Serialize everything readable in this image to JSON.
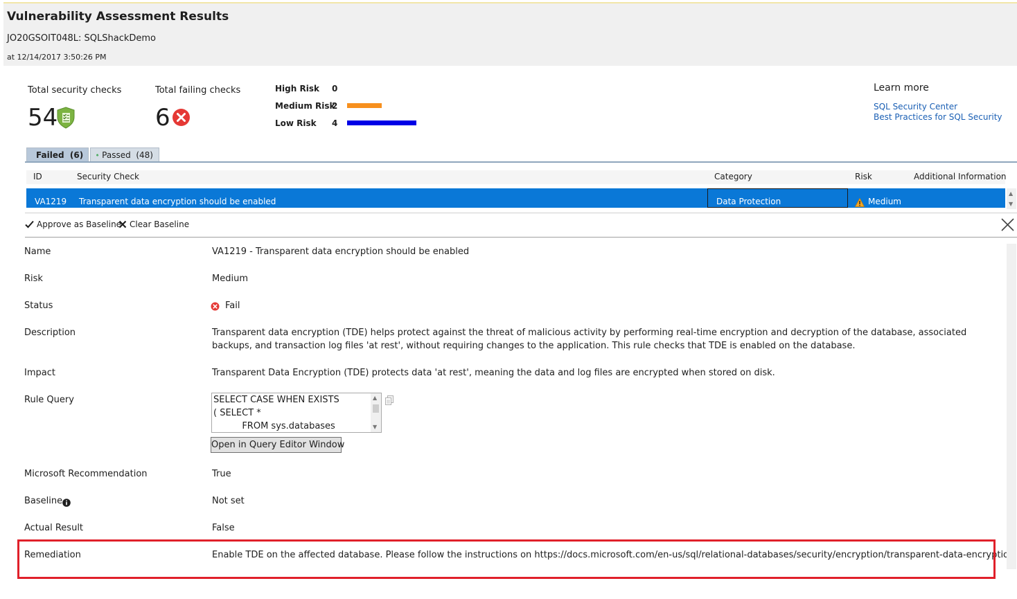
{
  "header": {
    "title": "Vulnerability Assessment Results",
    "server": "JO20GSOIT048L: SQLShackDemo",
    "timestamp": "at 12/14/2017 3:50:26 PM"
  },
  "summary": {
    "total_checks_label": "Total security checks",
    "total_checks": "54",
    "failing_label": "Total failing checks",
    "failing": "6",
    "risks": [
      {
        "label": "High Risk",
        "count": "0",
        "color": "#000000",
        "value": 0
      },
      {
        "label": "Medium Risk",
        "count": "2",
        "color": "#f7901e",
        "value": 2
      },
      {
        "label": "Low Risk",
        "count": "4",
        "color": "#0000e6",
        "value": 4
      }
    ]
  },
  "learn_more": {
    "title": "Learn more",
    "links": [
      "SQL Security Center",
      "Best Practices for SQL Security"
    ]
  },
  "tabs": {
    "failed": "Failed  (6)",
    "passed": "Passed  (48)"
  },
  "grid": {
    "columns": [
      "ID",
      "Security Check",
      "Category",
      "Risk",
      "Additional Information"
    ],
    "selected_row": {
      "id": "VA1219",
      "check": "Transparent data encryption should be enabled",
      "category": "Data Protection",
      "risk": "Medium"
    }
  },
  "toolbar": {
    "approve": "Approve as Baseline",
    "clear": "Clear Baseline"
  },
  "details": {
    "name_label": "Name",
    "name": "VA1219 - Transparent data encryption should be enabled",
    "risk_label": "Risk",
    "risk": "Medium",
    "status_label": "Status",
    "status": "Fail",
    "description_label": "Description",
    "description": "Transparent data encryption (TDE) helps protect against the threat of malicious activity by performing real-time encryption and decryption of the database, associated backups, and transaction log files 'at rest', without requiring changes to the application. This rule checks that TDE is enabled on the database.",
    "impact_label": "Impact",
    "impact": "Transparent Data Encryption (TDE) protects data 'at rest', meaning the data and log files are encrypted when stored on disk.",
    "rule_query_label": "Rule Query",
    "rule_query_lines": [
      "SELECT CASE WHEN EXISTS",
      "( SELECT *",
      "          FROM sys.databases"
    ],
    "open_query": "Open in Query Editor Window",
    "recommendation_label": "Microsoft Recommendation",
    "recommendation": "True",
    "baseline_label": "Baseline",
    "baseline": "Not set",
    "actual_label": "Actual Result",
    "actual": "False",
    "remediation_label": "Remediation",
    "remediation": "Enable TDE on the affected database. Please follow the instructions on https://docs.microsoft.com/en-us/sql/relational-databases/security/encryption/transparent-data-encryption"
  }
}
